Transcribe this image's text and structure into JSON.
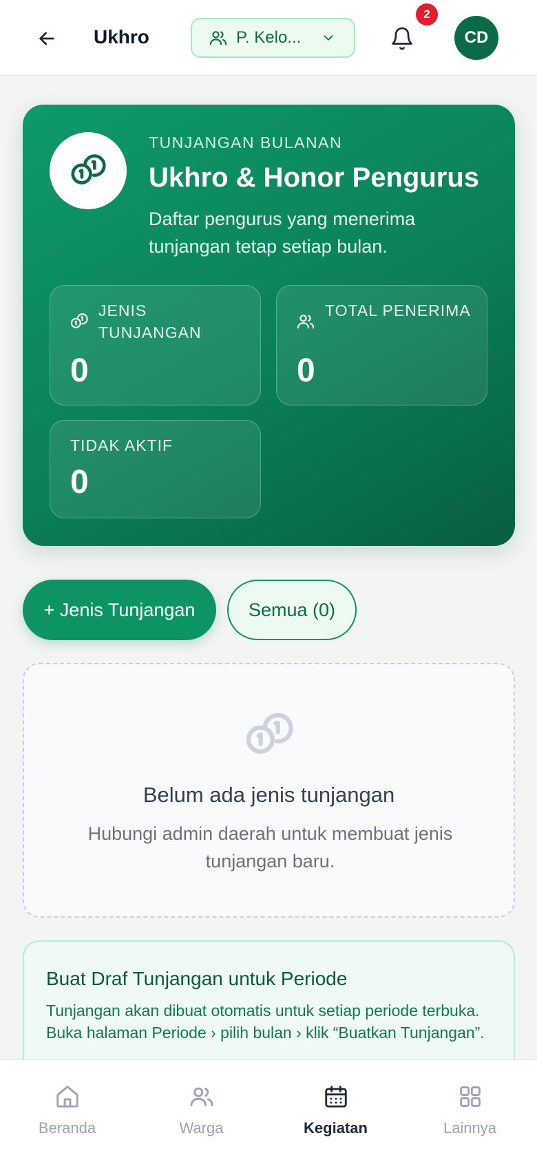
{
  "header": {
    "title": "Ukhro",
    "group_select_label": "P. Kelo...",
    "notification_count": "2",
    "avatar_initials": "CD"
  },
  "hero": {
    "eyebrow": "TUNJANGAN BULANAN",
    "title": "Ukhro & Honor Pengurus",
    "description": "Daftar pengurus yang menerima tunjangan tetap setiap bulan.",
    "stats": [
      {
        "label": "JENIS TUNJANGAN",
        "value": "0",
        "icon": "coins-icon"
      },
      {
        "label": "TOTAL PENERIMA",
        "value": "0",
        "icon": "users-icon"
      },
      {
        "label": "TIDAK AKTIF",
        "value": "0",
        "icon": ""
      }
    ]
  },
  "actions": {
    "add_label": "+ Jenis Tunjangan",
    "filter_label": "Semua (0)"
  },
  "empty_state": {
    "title": "Belum ada jenis tunjangan",
    "description": "Hubungi admin daerah untuk membuat jenis tunjangan baru."
  },
  "info_card": {
    "title": "Buat Draf Tunjangan untuk Periode",
    "description": "Tunjangan akan dibuat otomatis untuk setiap periode terbuka. Buka halaman Periode › pilih bulan › klik “Buatkan Tunjangan”."
  },
  "bottom_nav": {
    "items": [
      {
        "label": "Beranda",
        "icon": "home-icon"
      },
      {
        "label": "Warga",
        "icon": "users-icon"
      },
      {
        "label": "Kegiatan",
        "icon": "calendar-icon"
      },
      {
        "label": "Lainnya",
        "icon": "grid-icon"
      }
    ],
    "active": "Kegiatan"
  },
  "colors": {
    "brand": "#0e9462",
    "brand_dark": "#0b6b47",
    "badge": "#e11d2e"
  }
}
